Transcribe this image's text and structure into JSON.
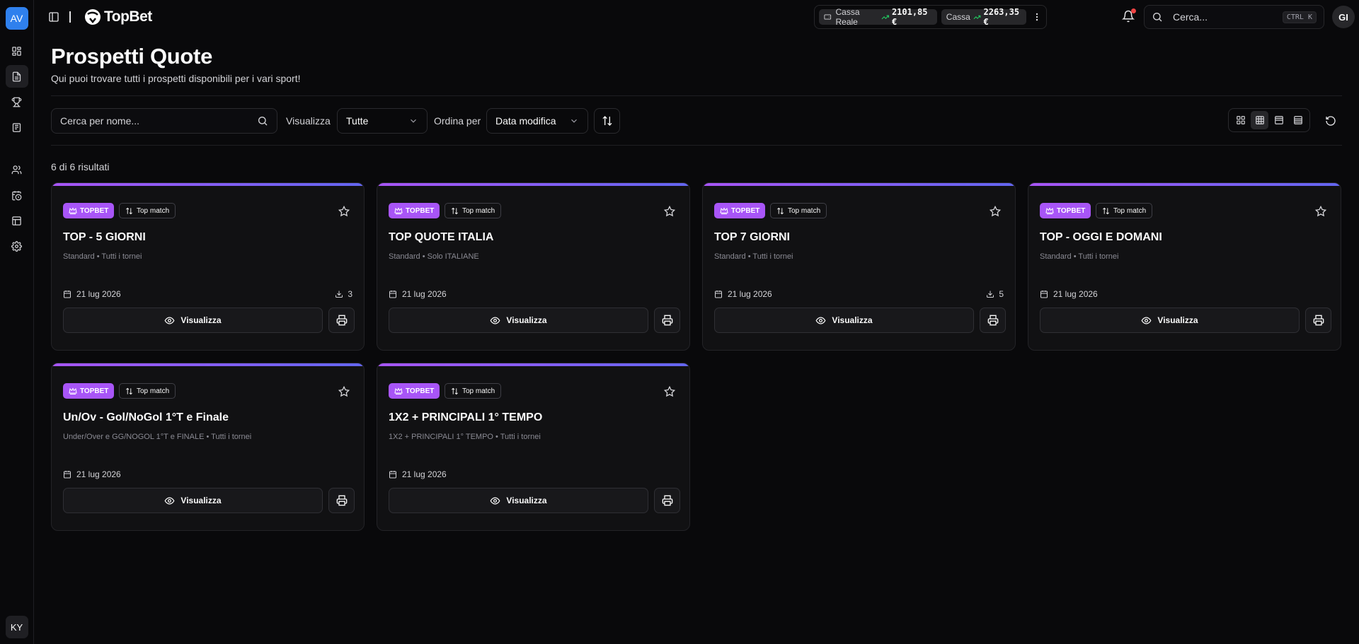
{
  "sidebar": {
    "workspace_initials": "AV",
    "user_initials": "KY",
    "items": [
      {
        "icon": "dashboard-icon"
      },
      {
        "icon": "document-icon"
      },
      {
        "icon": "trophy-icon"
      },
      {
        "icon": "newspaper-icon"
      },
      {
        "icon": "users-icon"
      },
      {
        "icon": "calendar-clock-icon"
      },
      {
        "icon": "table-icon"
      },
      {
        "icon": "gear-icon"
      }
    ]
  },
  "header": {
    "logo_text": "TopBet",
    "wallet": {
      "cassa_reale_label": "Cassa Reale",
      "cassa_reale_amount": "2101,85 €",
      "cassa_label": "Cassa",
      "cassa_amount": "2263,35 €"
    },
    "search_placeholder": "Cerca...",
    "search_shortcut": "CTRL K",
    "user_initials": "GI"
  },
  "page": {
    "title": "Prospetti Quote",
    "subtitle": "Qui puoi trovare tutti i prospetti disponibili per i vari sport!"
  },
  "toolbar": {
    "search_placeholder": "Cerca per nome...",
    "view_label": "Visualizza",
    "view_value": "Tutte",
    "sort_label": "Ordina per",
    "sort_value": "Data modifica"
  },
  "results_text": "6 di 6 risultati",
  "cards": [
    {
      "badge": "TOPBET",
      "tag": "Top match",
      "title": "TOP - 5 GIORNI",
      "subtitle": "Standard • Tutti i tornei",
      "date": "21 lug 2026",
      "downloads": "3",
      "view_label": "Visualizza"
    },
    {
      "badge": "TOPBET",
      "tag": "Top match",
      "title": "TOP QUOTE ITALIA",
      "subtitle": "Standard • Solo ITALIANE",
      "date": "21 lug 2026",
      "downloads": "",
      "view_label": "Visualizza"
    },
    {
      "badge": "TOPBET",
      "tag": "Top match",
      "title": "TOP 7 GIORNI",
      "subtitle": "Standard • Tutti i tornei",
      "date": "21 lug 2026",
      "downloads": "5",
      "view_label": "Visualizza"
    },
    {
      "badge": "TOPBET",
      "tag": "Top match",
      "title": "TOP - OGGI E DOMANI",
      "subtitle": "Standard • Tutti i tornei",
      "date": "21 lug 2026",
      "downloads": "",
      "view_label": "Visualizza"
    },
    {
      "badge": "TOPBET",
      "tag": "Top match",
      "title": "Un/Ov - Gol/NoGol 1°T e Finale",
      "subtitle": "Under/Over e GG/NOGOL 1°T e FINALE • Tutti i tornei",
      "date": "21 lug 2026",
      "downloads": "",
      "view_label": "Visualizza"
    },
    {
      "badge": "TOPBET",
      "tag": "Top match",
      "title": "1X2 + PRINCIPALI 1° TEMPO",
      "subtitle": "1X2 + PRINCIPALI 1° TEMPO • Tutti i tornei",
      "date": "21 lug 2026",
      "downloads": "",
      "view_label": "Visualizza"
    }
  ],
  "colors": {
    "accent": "#a855f7",
    "accent_gradient_end": "#6366f1",
    "background": "#09090b",
    "card_background": "#111113",
    "trend_up": "#22c55e",
    "notification_dot": "#ef4444"
  }
}
